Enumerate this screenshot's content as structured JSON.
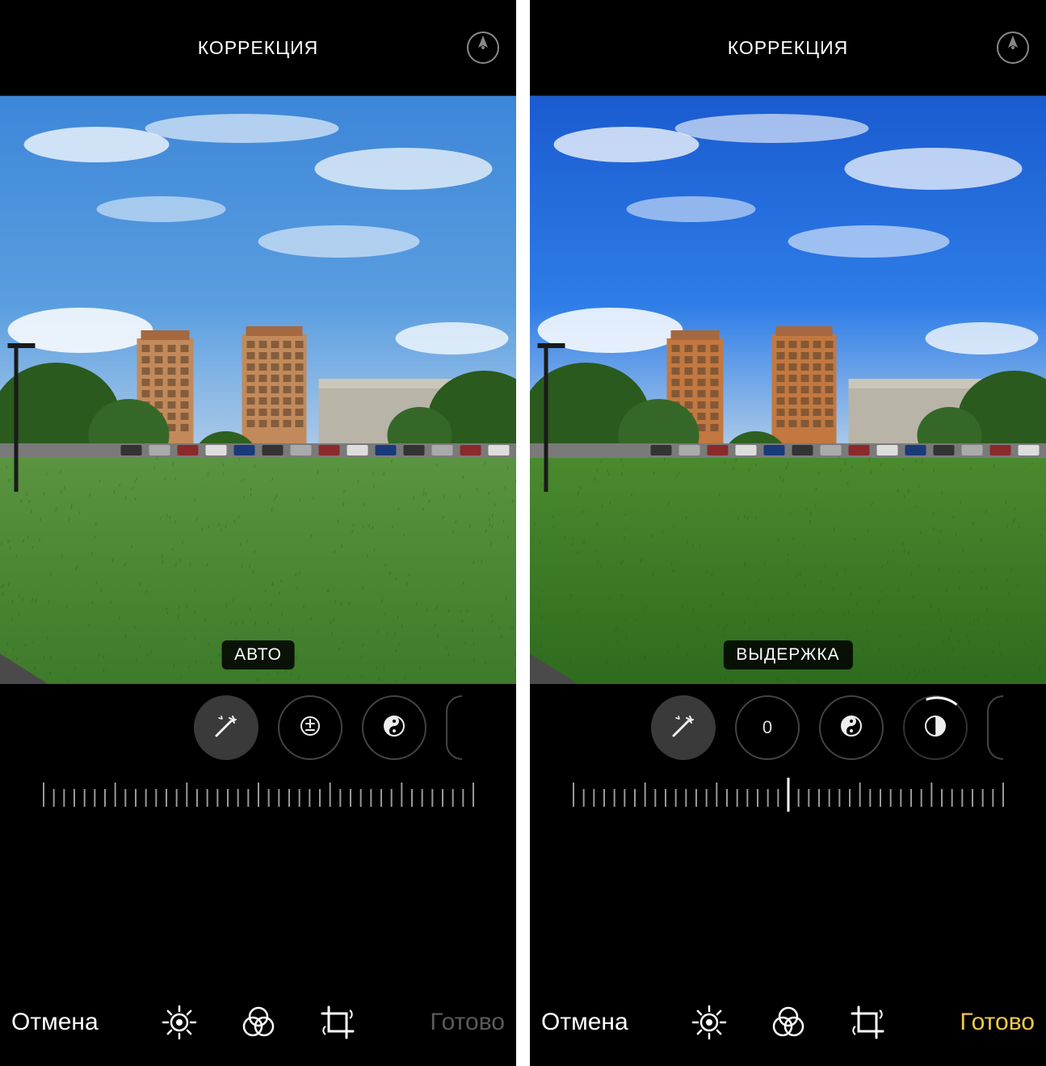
{
  "panes": [
    {
      "title": "КОРРЕКЦИЯ",
      "chip": "АВТО",
      "dial_center_text": "",
      "cancel": "Отмена",
      "done": "Готово",
      "done_state": "gray",
      "sky_saturation": 1.0,
      "active_tool": "wand",
      "dial_layout": "left"
    },
    {
      "title": "КОРРЕКЦИЯ",
      "chip": "ВЫДЕРЖКА",
      "dial_center_text": "0",
      "cancel": "Отмена",
      "done": "Готово",
      "done_state": "gold",
      "sky_saturation": 1.25,
      "active_tool": "highlights",
      "dial_layout": "right"
    }
  ],
  "tools": {
    "wand": "magic-wand-icon",
    "exposure": "exposure-icon",
    "brilliance": "yin-yang-icon",
    "highlights": "half-circle-icon"
  },
  "tabs": [
    "adjust-icon",
    "filters-icon",
    "crop-icon"
  ]
}
